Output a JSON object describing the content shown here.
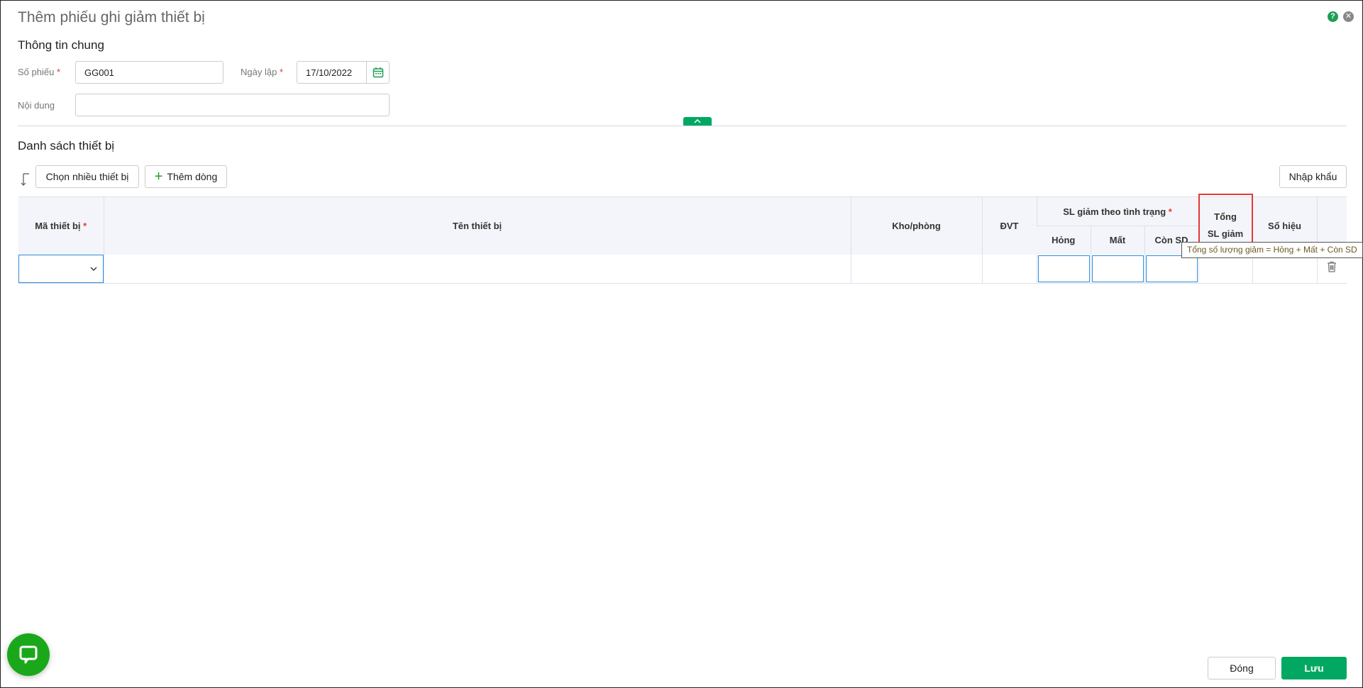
{
  "title": "Thêm phiếu ghi giảm thiết bị",
  "general": {
    "heading": "Thông tin chung",
    "so_phieu_label": "Số phiếu",
    "so_phieu_value": "GG001",
    "ngay_lap_label": "Ngày lập",
    "ngay_lap_value": "17/10/2022",
    "noi_dung_label": "Nội dung",
    "noi_dung_value": "",
    "required_mark": "*"
  },
  "list": {
    "heading": "Danh sách thiết bị",
    "choose_many": "Chọn nhiều thiết bị",
    "add_row": "Thêm dòng",
    "import": "Nhập khẩu"
  },
  "table": {
    "columns": {
      "ma": "Mã thiết bị",
      "ten": "Tên thiết bị",
      "kho": "Kho/phòng",
      "dvt": "ĐVT",
      "sl_group": "SL giảm theo tình trạng",
      "hong": "Hỏng",
      "mat": "Mất",
      "con_sd": "Còn SD",
      "tong": "Tổng SL giảm",
      "so_hieu": "Số hiệu"
    },
    "tooltip": "Tổng số lượng giảm = Hỏng + Mất + Còn SD"
  },
  "footer": {
    "close": "Đóng",
    "save": "Lưu"
  },
  "colors": {
    "accent": "#00a862",
    "highlight": "#e53935",
    "input_focus": "#2c8ce0",
    "chat": "#1aa81a"
  }
}
